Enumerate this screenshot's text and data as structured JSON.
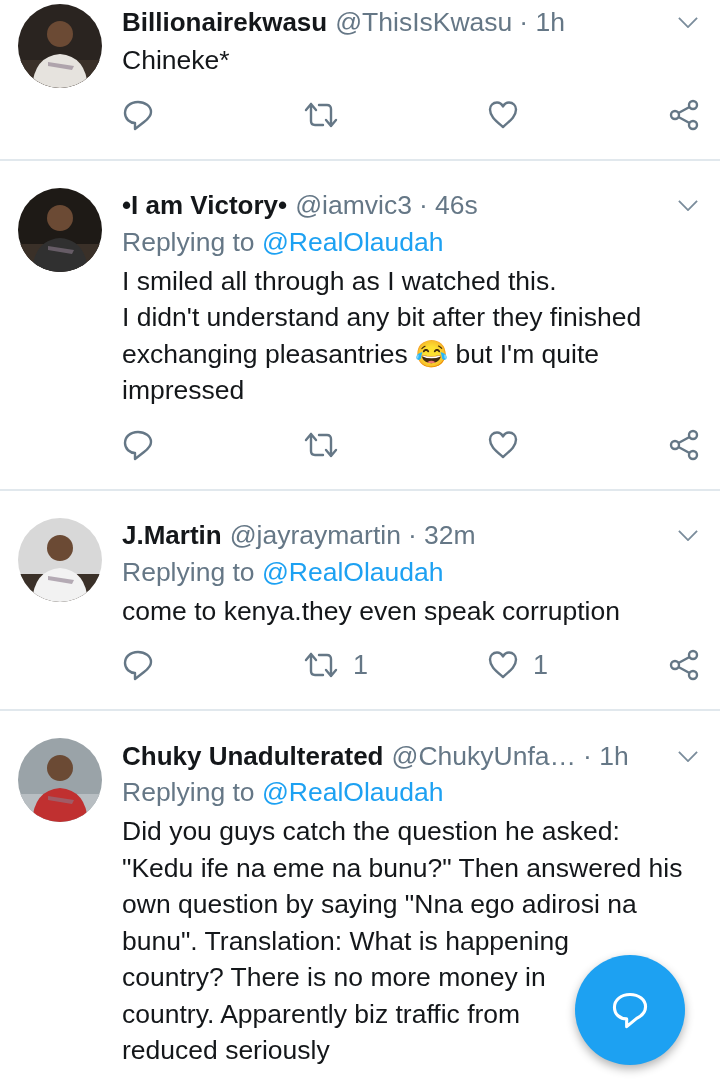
{
  "tweets": [
    {
      "name": "Billionairekwasu",
      "handle": "@ThisIsKwasu",
      "time": "· 1h",
      "body": [
        "Chineke*"
      ]
    },
    {
      "name": "•I am Victory•",
      "handle": "@iamvic3",
      "time": "· 46s",
      "replying_prefix": "Replying to",
      "replying_to": "@RealOlaudah",
      "body": [
        "I smiled all through as I watched this.",
        "I didn't understand any bit after they finished",
        "exchanging pleasantries 😂 but I'm quite",
        "impressed"
      ]
    },
    {
      "name": "J.Martin",
      "handle": "@jayraymartin",
      "time": "· 32m",
      "replying_prefix": "Replying to",
      "replying_to": "@RealOlaudah",
      "body": [
        "come to kenya.they even speak corruption"
      ],
      "retweets": "1",
      "likes": "1"
    },
    {
      "name": "Chuky Unadulterated",
      "handle": "@ChukyUnfa…",
      "time": "· 1h",
      "replying_prefix": "Replying to",
      "replying_to": "@RealOlaudah",
      "body": [
        "Did you guys catch the question he asked:",
        "\"Kedu ife na eme na bunu?\" Then answered his",
        "own question by saying \"Nna ego adirosi na",
        "bunu\". Translation: What is happening",
        "country? There is no more money in",
        "country. Apparently biz traffic from",
        "reduced seriously"
      ]
    }
  ]
}
